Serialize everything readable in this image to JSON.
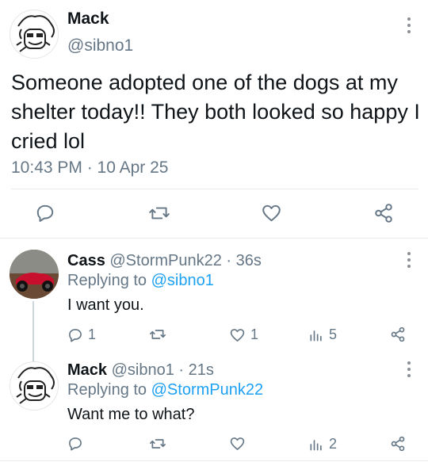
{
  "main_tweet": {
    "author_name": "Mack",
    "author_handle": "@sibno1",
    "text": "Someone adopted one of the dogs at my shelter today!! They both looked so happy I cried lol",
    "timestamp": "10:43 PM · 10 Apr 25"
  },
  "replies": [
    {
      "author_name": "Cass",
      "author_handle": "@StormPunk22",
      "time": "· 36s",
      "replying_label": "Replying to",
      "replying_handle": "@sibno1",
      "text": "I want you.",
      "reply_count": "1",
      "retweet_count": "",
      "like_count": "1",
      "views_count": "5"
    },
    {
      "author_name": "Mack",
      "author_handle": "@sibno1",
      "time": "· 21s",
      "replying_label": "Replying to",
      "replying_handle": "@StormPunk22",
      "text": "Want me to what?",
      "reply_count": "",
      "retweet_count": "",
      "like_count": "",
      "views_count": "2"
    }
  ],
  "icons": {
    "reply": "reply-icon",
    "retweet": "retweet-icon",
    "like": "heart-icon",
    "views": "views-icon",
    "share": "share-icon",
    "more": "more-icon"
  },
  "colors": {
    "text": "#0f1419",
    "muted": "#657786",
    "link": "#1da1f2",
    "divider": "#e6ecf0"
  }
}
